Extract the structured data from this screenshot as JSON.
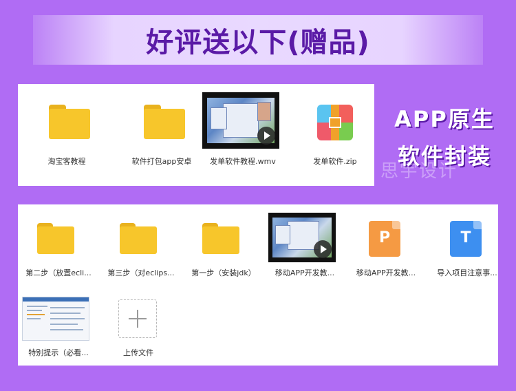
{
  "banner": {
    "title": "好评送以下(赠品)"
  },
  "side": {
    "line1": "APP原生",
    "line2": "软件封装"
  },
  "watermark": "思宇设计",
  "panel1": {
    "items": [
      {
        "label": "淘宝客教程",
        "type": "folder"
      },
      {
        "label": "软件打包app安卓",
        "type": "folder"
      },
      {
        "label": "发单软件教程.wmv",
        "type": "video"
      },
      {
        "label": "发单软件.zip",
        "type": "zip"
      }
    ]
  },
  "panel2": {
    "items": [
      {
        "label": "第二步（放置ecli...",
        "type": "folder"
      },
      {
        "label": "第三步（对eclips...",
        "type": "folder"
      },
      {
        "label": "第一步（安装jdk）",
        "type": "folder"
      },
      {
        "label": "移动APP开发教...",
        "type": "video"
      },
      {
        "label": "移动APP开发教...",
        "type": "ppt",
        "glyph": "P"
      },
      {
        "label": "导入项目注意事...",
        "type": "doc",
        "glyph": "T"
      },
      {
        "label": "特别提示（必看...",
        "type": "screenshot"
      },
      {
        "label": "上传文件",
        "type": "upload"
      }
    ]
  },
  "colors": {
    "background": "#b06cf4",
    "banner_text": "#5a1aa6",
    "folder": "#f7c62b",
    "ppt": "#f59a43",
    "doc": "#3d8ff0"
  }
}
